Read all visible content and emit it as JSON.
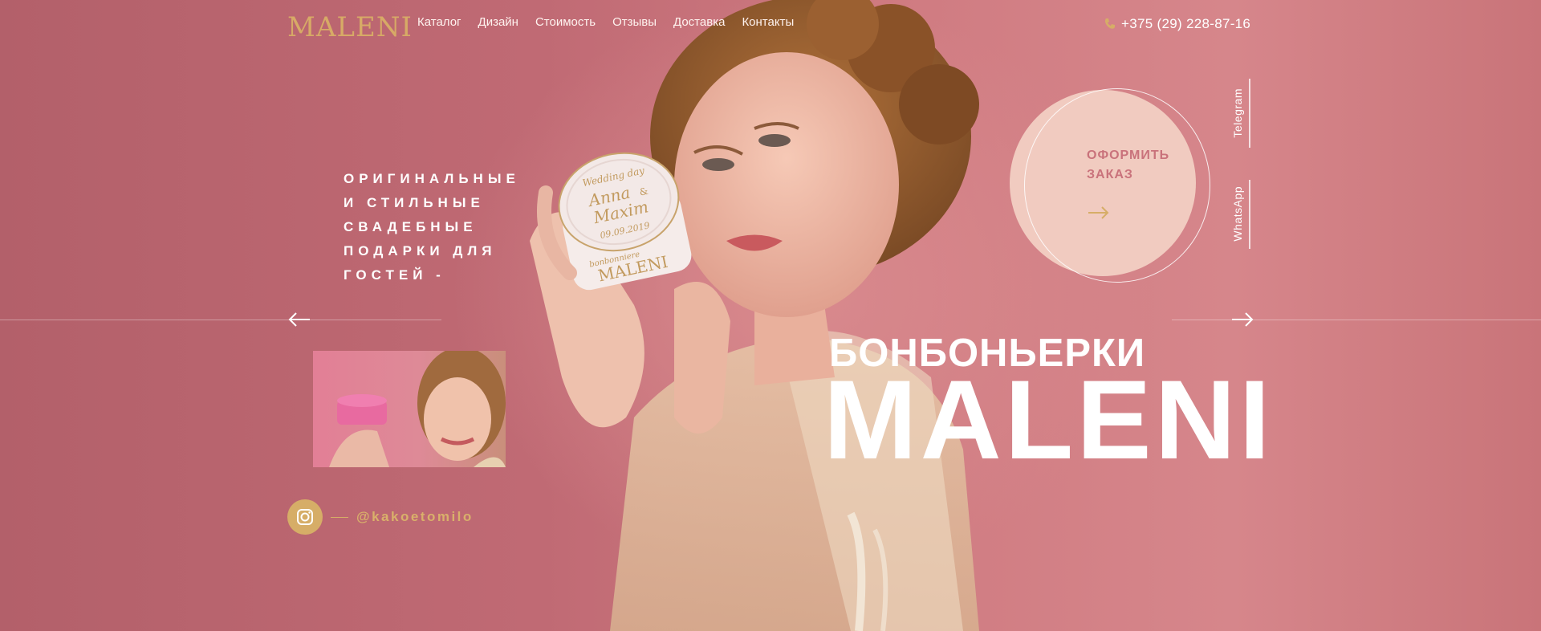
{
  "header": {
    "logo": "MALENI",
    "nav": [
      "Каталог",
      "Дизайн",
      "Стоимость",
      "Отзывы",
      "Доставка",
      "Контакты"
    ],
    "phone": "+375 (29) 228-87-16"
  },
  "hero": {
    "tagline": "Оригинальные и стильные свадебные подарки для гостей -",
    "subtitle": "БОНБОНЬЕРКИ",
    "title": "MALENI"
  },
  "product": {
    "jar_lines": [
      "Wedding day",
      "Anna",
      "&",
      "Maxim",
      "09.09.2019"
    ],
    "jar_brand": "MALENI",
    "jar_brand_small": "bonbonniere"
  },
  "order": {
    "label_line1": "ОФОРМИТЬ",
    "label_line2": "ЗАКАЗ"
  },
  "social": {
    "telegram": "Telegram",
    "whatsapp": "WhatsApp",
    "instagram_handle": "@kakoetomilo"
  },
  "colors": {
    "accent_gold": "#d6ad67",
    "background_pink": "#c9707a",
    "circle_fill": "#f1cbc0",
    "order_text": "#c9727b"
  },
  "icons": {
    "phone": "phone-icon",
    "prev": "arrow-left-icon",
    "next": "arrow-right-icon",
    "order": "arrow-right-icon",
    "instagram": "instagram-icon"
  }
}
